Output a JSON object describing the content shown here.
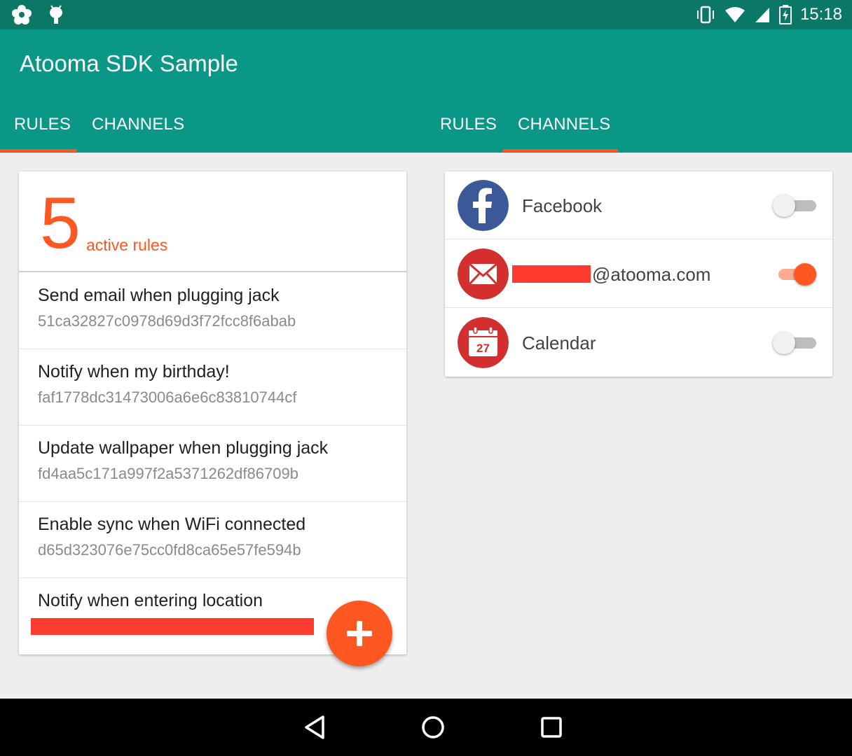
{
  "status_bar": {
    "time": "15:18",
    "left_icons": [
      "flower-icon",
      "android-debug-icon"
    ],
    "right_icons": [
      "vibrate-icon",
      "wifi-icon",
      "signal-icon",
      "battery-charging-icon"
    ]
  },
  "app": {
    "title": "Atooma SDK Sample",
    "primary_color": "#0a9787",
    "status_color": "#0a7767",
    "accent_color": "#ff5722"
  },
  "tabs_left": [
    {
      "label": "RULES",
      "selected": true
    },
    {
      "label": "CHANNELS",
      "selected": false
    }
  ],
  "tabs_right": [
    {
      "label": "RULES",
      "selected": false
    },
    {
      "label": "CHANNELS",
      "selected": true
    }
  ],
  "rules": {
    "count": "5",
    "count_label": "active rules",
    "items": [
      {
        "title": "Send email when plugging jack",
        "id": "51ca32827c0978d69d3f72fcc8f6abab"
      },
      {
        "title": "Notify when my birthday!",
        "id": "faf1778dc31473006a6e6c83810744cf"
      },
      {
        "title": "Update wallpaper when plugging jack",
        "id": "fd4aa5c171a997f2a5371262df86709b"
      },
      {
        "title": "Enable sync when WiFi connected",
        "id": "d65d323076e75cc0fd8ca65e57fe594b"
      },
      {
        "title": "Notify when entering location",
        "id": ""
      }
    ],
    "fab_icon": "plus-icon"
  },
  "channels": [
    {
      "name": "Facebook",
      "icon": "facebook-icon",
      "enabled": false
    },
    {
      "name": "@atooma.com",
      "icon": "mail-icon",
      "enabled": true
    },
    {
      "name": "Calendar",
      "icon": "calendar-icon",
      "enabled": false,
      "icon_day": "27"
    }
  ],
  "nav_bar": [
    "back-icon",
    "home-icon",
    "recents-icon"
  ]
}
